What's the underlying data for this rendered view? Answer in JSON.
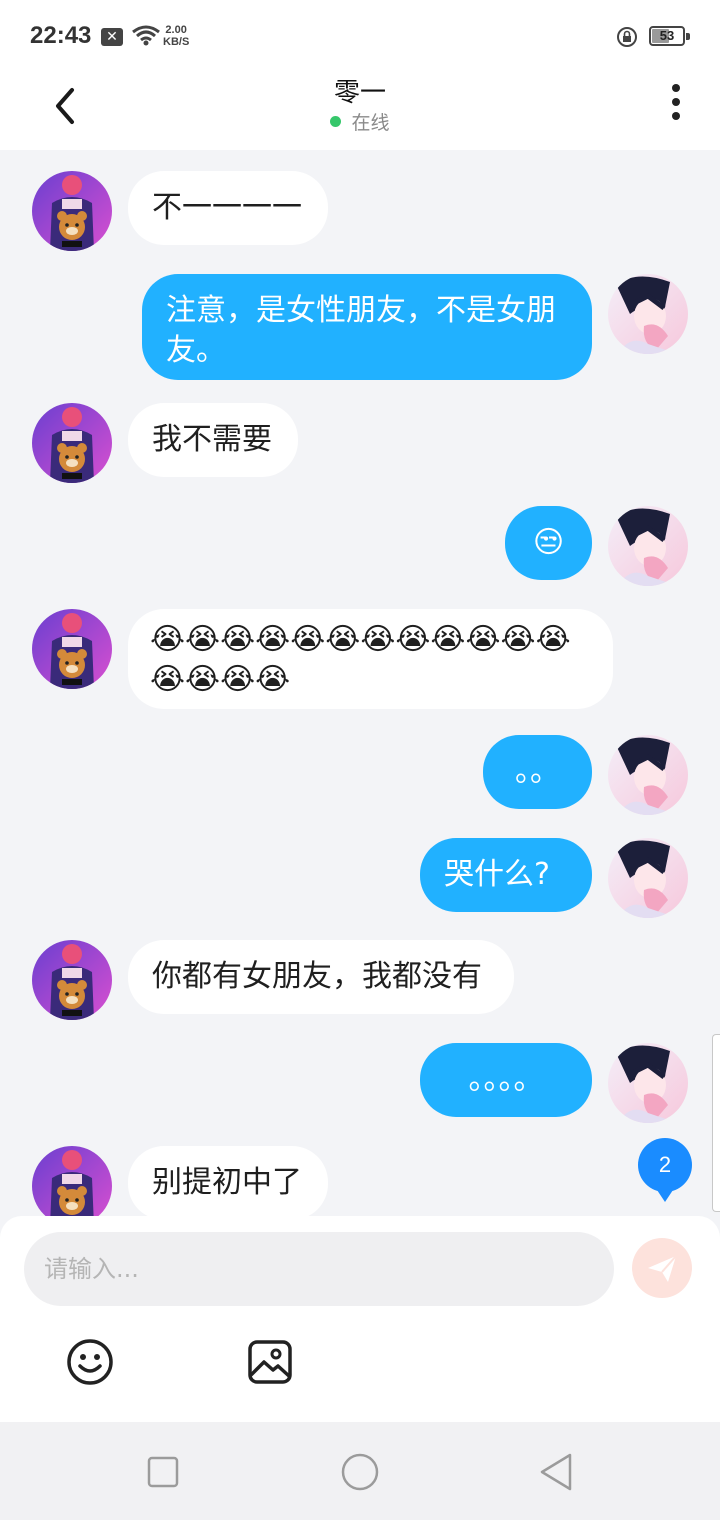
{
  "status_bar": {
    "time": "22:43",
    "notif_x": "✕",
    "speed_value": "2.00",
    "speed_unit": "KB/S",
    "battery": "53",
    "battery_level": 0.53
  },
  "header": {
    "title": "零一",
    "status": "在线",
    "status_color": "#36c76b"
  },
  "messages": [
    {
      "side": "in",
      "text": "不一一一一"
    },
    {
      "side": "out",
      "text": "注意，是女性朋友，不是女朋友。"
    },
    {
      "side": "in",
      "text": "我不需要"
    },
    {
      "side": "out",
      "text": "😒"
    },
    {
      "side": "in",
      "text": "😭😭😭😭😭😭😭😭😭😭😭😭😭😭😭😭"
    },
    {
      "side": "out",
      "text": "。。"
    },
    {
      "side": "out",
      "text": "哭什么?"
    },
    {
      "side": "in",
      "text": "你都有女朋友，我都没有"
    },
    {
      "side": "out",
      "text": "。。。。"
    },
    {
      "side": "in",
      "text": "别提初中了"
    }
  ],
  "unread_count": "2",
  "composer": {
    "placeholder": "请输入..."
  },
  "icons": {
    "back": "chevron-left-icon",
    "more": "more-vertical-icon",
    "send": "paper-plane-icon",
    "emoji": "smiley-icon",
    "image": "image-icon",
    "nav_recent": "square-icon",
    "nav_home": "circle-icon",
    "nav_back": "triangle-icon"
  },
  "colors": {
    "outgoing_bubble": "#21b1ff",
    "incoming_bubble": "#ffffff",
    "background": "#f3f4f7",
    "unread_badge": "#1a8cff",
    "send_button": "#fde2dc"
  }
}
